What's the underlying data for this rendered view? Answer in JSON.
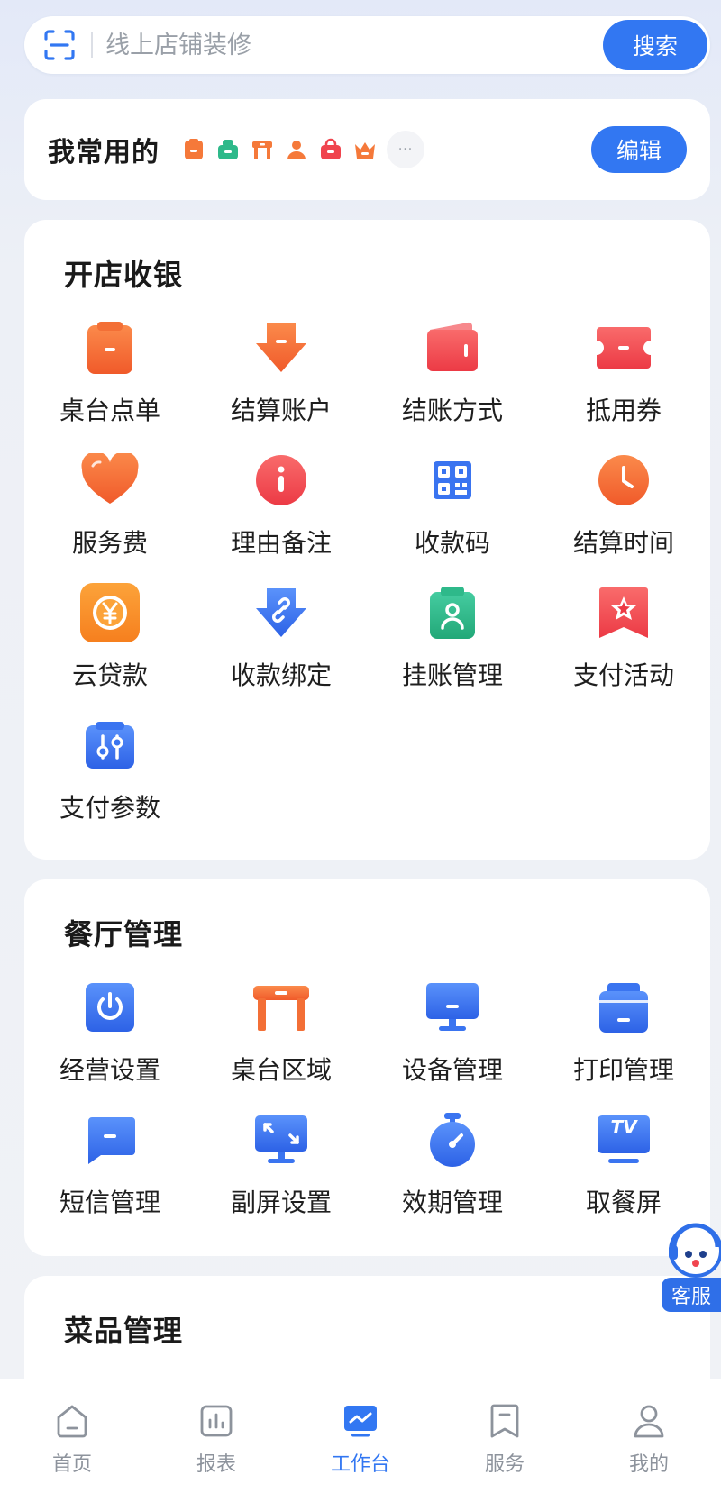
{
  "search": {
    "placeholder": "线上店铺装修",
    "button_label": "搜索"
  },
  "favorites": {
    "title": "我常用的",
    "edit_label": "编辑",
    "icons": [
      "menu-icon",
      "cashier-icon",
      "table-icon",
      "person-icon",
      "bag-icon",
      "crown-icon"
    ],
    "more_label": "···"
  },
  "sections": [
    {
      "title": "开店收银",
      "items": [
        {
          "label": "桌台点单",
          "icon": "clipboard-icon"
        },
        {
          "label": "结算账户",
          "icon": "settle-account-icon"
        },
        {
          "label": "结账方式",
          "icon": "wallet-icon"
        },
        {
          "label": "抵用券",
          "icon": "coupon-icon"
        },
        {
          "label": "服务费",
          "icon": "heart-icon"
        },
        {
          "label": "理由备注",
          "icon": "info-icon"
        },
        {
          "label": "收款码",
          "icon": "qr-code-icon"
        },
        {
          "label": "结算时间",
          "icon": "clock-icon"
        },
        {
          "label": "云贷款",
          "icon": "yuan-loan-icon"
        },
        {
          "label": "收款绑定",
          "icon": "link-icon"
        },
        {
          "label": "挂账管理",
          "icon": "credit-icon"
        },
        {
          "label": "支付活动",
          "icon": "star-badge-icon"
        },
        {
          "label": "支付参数",
          "icon": "parameters-icon"
        }
      ]
    },
    {
      "title": "餐厅管理",
      "items": [
        {
          "label": "经营设置",
          "icon": "power-icon"
        },
        {
          "label": "桌台区域",
          "icon": "table-area-icon"
        },
        {
          "label": "设备管理",
          "icon": "monitor-icon"
        },
        {
          "label": "打印管理",
          "icon": "printer-icon"
        },
        {
          "label": "短信管理",
          "icon": "message-icon"
        },
        {
          "label": "副屏设置",
          "icon": "second-screen-icon"
        },
        {
          "label": "效期管理",
          "icon": "timer-icon"
        },
        {
          "label": "取餐屏",
          "icon": "tv-icon",
          "badge": "TV"
        }
      ]
    },
    {
      "title": "菜品管理",
      "items": []
    }
  ],
  "customer_service": {
    "label": "客服"
  },
  "bottom_nav": [
    {
      "label": "首页",
      "icon": "home-icon",
      "active": false
    },
    {
      "label": "报表",
      "icon": "report-icon",
      "active": false
    },
    {
      "label": "工作台",
      "icon": "workbench-icon",
      "active": true
    },
    {
      "label": "服务",
      "icon": "bookmark-icon",
      "active": false
    },
    {
      "label": "我的",
      "icon": "user-icon",
      "active": false
    }
  ],
  "colors": {
    "primary": "#3277F2",
    "orange": "#F5793A",
    "red": "#F0444E",
    "green": "#2EB98A",
    "blue": "#3A74F0"
  }
}
